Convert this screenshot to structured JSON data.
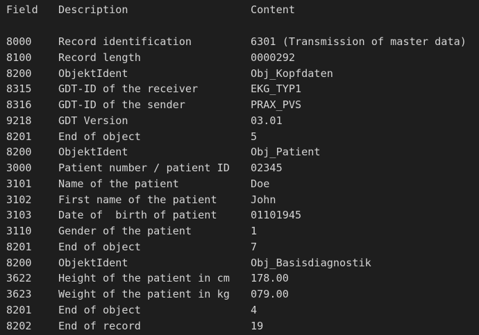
{
  "headers": {
    "field": "Field",
    "description": "Description",
    "content": "Content"
  },
  "rows": [
    {
      "field": "8000",
      "description": "Record identification",
      "content": "6301 (Transmission of master data)"
    },
    {
      "field": "8100",
      "description": "Record length",
      "content": "0000292"
    },
    {
      "field": "8200",
      "description": "ObjektIdent",
      "content": "Obj_Kopfdaten"
    },
    {
      "field": "8315",
      "description": "GDT-ID of the receiver",
      "content": "EKG_TYP1"
    },
    {
      "field": "8316",
      "description": "GDT-ID of the sender",
      "content": "PRAX_PVS"
    },
    {
      "field": "9218",
      "description": "GDT Version",
      "content": "03.01"
    },
    {
      "field": "8201",
      "description": "End of object",
      "content": "5"
    },
    {
      "field": "8200",
      "description": "ObjektIdent",
      "content": "Obj_Patient"
    },
    {
      "field": "3000",
      "description": "Patient number / patient ID",
      "content": "02345"
    },
    {
      "field": "3101",
      "description": "Name of the patient",
      "content": "Doe"
    },
    {
      "field": "3102",
      "description": "First name of the patient",
      "content": "John"
    },
    {
      "field": "3103",
      "description": "Date of  birth of patient",
      "content": "01101945"
    },
    {
      "field": "3110",
      "description": "Gender of the patient",
      "content": "1"
    },
    {
      "field": "8201",
      "description": "End of object",
      "content": "7"
    },
    {
      "field": "8200",
      "description": "ObjektIdent",
      "content": "Obj_Basisdiagnostik"
    },
    {
      "field": "3622",
      "description": "Height of the patient in cm",
      "content": "178.00"
    },
    {
      "field": "3623",
      "description": "Weight of the patient in kg",
      "content": "079.00"
    },
    {
      "field": "8201",
      "description": "End of object",
      "content": "4"
    },
    {
      "field": "8202",
      "description": "End of record",
      "content": "19"
    }
  ],
  "colors": {
    "background": "#1e1e1e",
    "text": "#d4d4d4"
  }
}
